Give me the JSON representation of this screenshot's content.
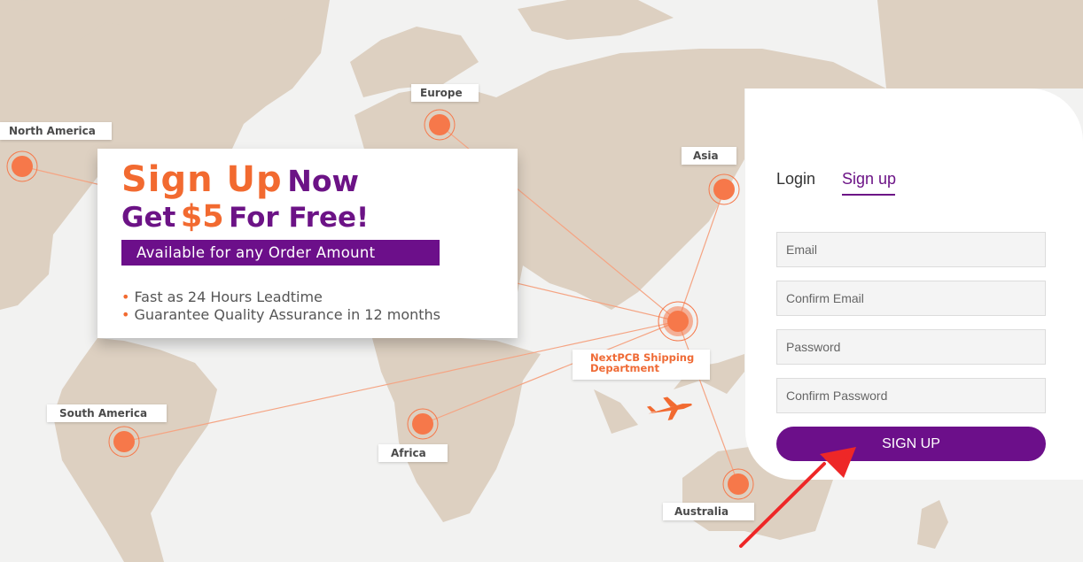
{
  "map": {
    "regions": {
      "north_america": "North America",
      "europe": "Europe",
      "asia": "Asia",
      "south_america": "South America",
      "africa": "Africa",
      "australia": "Australia"
    },
    "hub_label": "NextPCB Shipping Department",
    "hub_line1": "NextPCB Shipping",
    "hub_line2": "Department",
    "land_color": "#ddd0c1",
    "connector_color": "#f5a483",
    "marker_color": "#f6784a"
  },
  "promo": {
    "sign_up": "Sign Up",
    "now": "Now",
    "get": "Get",
    "amount": "$5",
    "for_free": "For Free!",
    "banner": "Available for any Order Amount",
    "bullets": [
      "Fast as 24 Hours Leadtime",
      "Guarantee Quality Assurance in 12 months"
    ],
    "accent_orange": "#f26a30",
    "accent_purple": "#6c1386"
  },
  "auth": {
    "tabs": {
      "login": "Login",
      "signup": "Sign up",
      "active": "signup"
    },
    "fields": {
      "email": "Email",
      "confirm_email": "Confirm Email",
      "password": "Password",
      "confirm_password": "Confirm Password"
    },
    "submit": "SIGN UP",
    "button_color": "#6c0f8a"
  },
  "annotation": {
    "arrow_color": "#ee2727",
    "icon": "red-pointer-arrow"
  },
  "plane_icon": "airplane-icon"
}
